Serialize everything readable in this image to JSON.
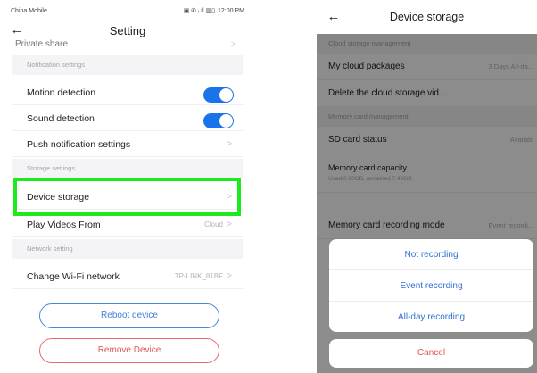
{
  "left_screen": {
    "status_bar": {
      "carrier": "China Mobile",
      "icons_text": "▣ ✆ ᵢ.ıl ▥▯",
      "time": "12:00 PM"
    },
    "header": {
      "title": "Setting"
    },
    "cut_off_row": {
      "label": "Private share"
    },
    "sections": {
      "notification_header": "Notification settings",
      "storage_header": "Storage settings",
      "network_header": "Network setting"
    },
    "rows": {
      "motion_detection": {
        "label": "Motion detection",
        "enabled": true
      },
      "sound_detection": {
        "label": "Sound detection",
        "enabled": true
      },
      "push_notification": {
        "label": "Push notification settings"
      },
      "device_storage": {
        "label": "Device storage"
      },
      "play_videos_from": {
        "label": "Play Videos From",
        "value": "Cloud"
      },
      "change_wifi": {
        "label": "Change Wi-Fi network",
        "value": "TP-LINK_81BF"
      }
    },
    "buttons": {
      "reboot": "Reboot device",
      "remove": "Remove Device"
    },
    "colors": {
      "toggle_on": "#1a73e8",
      "highlight": "#1ee81e",
      "reboot": "#3f7fd8",
      "remove": "#e05555"
    }
  },
  "right_screen": {
    "header": {
      "title": "Device storage"
    },
    "sections": {
      "cloud_header": "Cloud storage management",
      "memory_header": "Memory card management"
    },
    "rows": {
      "cloud_packages": {
        "label": "My cloud packages",
        "value": "3 Days All-da..."
      },
      "delete_cloud": {
        "label": "Delete the cloud storage vid..."
      },
      "sd_status": {
        "label": "SD card status",
        "value": "Availabl"
      },
      "memory_capacity": {
        "label": "Memory card capacity",
        "sub": "Used 0.00GB, remained 7.40GB"
      },
      "recording_mode": {
        "label": "Memory card recording mode",
        "value": "Event recordi..."
      }
    },
    "action_sheet": {
      "options": [
        "Not recording",
        "Event recording",
        "All-day recording"
      ],
      "cancel": "Cancel"
    }
  }
}
